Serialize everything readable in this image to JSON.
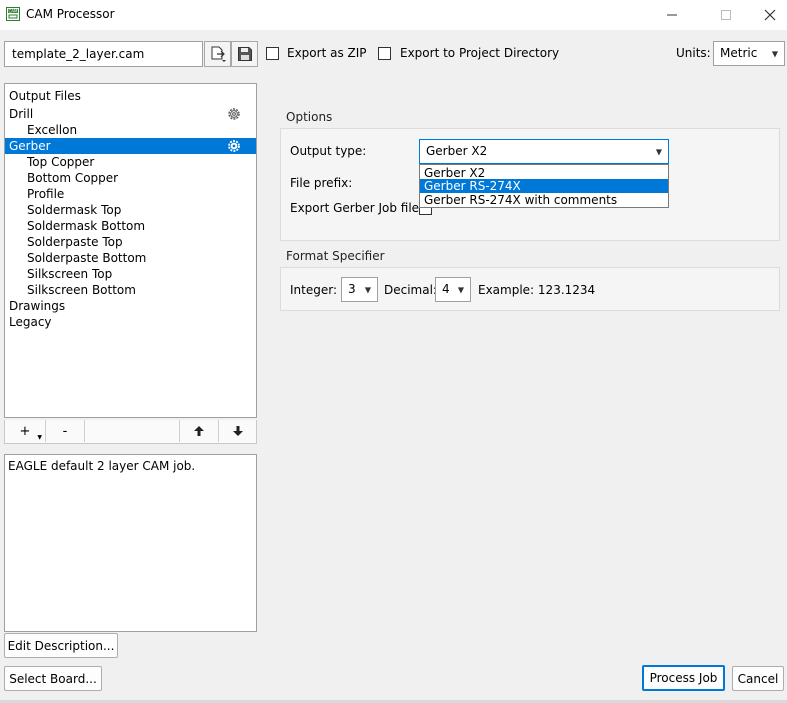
{
  "window": {
    "title": "CAM Processor",
    "icon": "cam-app-icon",
    "controls": [
      "minimize-icon",
      "maximize-icon",
      "close-icon"
    ]
  },
  "toolbar": {
    "job_file": "template_2_layer.cam",
    "open_icon": "open-file-icon",
    "save_icon": "save-icon",
    "export_zip": {
      "label": "Export as ZIP",
      "checked": false
    },
    "export_project_dir": {
      "label": "Export to Project Directory",
      "checked": false
    },
    "units_label": "Units:",
    "units_value": "Metric"
  },
  "tree": {
    "items": [
      {
        "label": "Output Files",
        "level": 0,
        "selected": false,
        "gear": false
      },
      {
        "label": "Drill",
        "level": 0,
        "selected": false,
        "gear": true
      },
      {
        "label": "Excellon",
        "level": 1,
        "selected": false,
        "gear": false
      },
      {
        "label": "Gerber",
        "level": 0,
        "selected": true,
        "gear": true
      },
      {
        "label": "Top Copper",
        "level": 1,
        "selected": false,
        "gear": false
      },
      {
        "label": "Bottom Copper",
        "level": 1,
        "selected": false,
        "gear": false
      },
      {
        "label": "Profile",
        "level": 1,
        "selected": false,
        "gear": false
      },
      {
        "label": "Soldermask Top",
        "level": 1,
        "selected": false,
        "gear": false
      },
      {
        "label": "Soldermask Bottom",
        "level": 1,
        "selected": false,
        "gear": false
      },
      {
        "label": "Solderpaste Top",
        "level": 1,
        "selected": false,
        "gear": false
      },
      {
        "label": "Solderpaste Bottom",
        "level": 1,
        "selected": false,
        "gear": false
      },
      {
        "label": "Silkscreen Top",
        "level": 1,
        "selected": false,
        "gear": false
      },
      {
        "label": "Silkscreen Bottom",
        "level": 1,
        "selected": false,
        "gear": false
      },
      {
        "label": "Drawings",
        "level": 0,
        "selected": false,
        "gear": false
      },
      {
        "label": "Legacy",
        "level": 0,
        "selected": false,
        "gear": false
      }
    ],
    "toolbar": {
      "add": "+",
      "remove": "-",
      "up_icon": "arrow-up-icon",
      "down_icon": "arrow-down-icon"
    }
  },
  "description": {
    "text": "EAGLE default 2 layer CAM job.",
    "edit_button": "Edit Description..."
  },
  "options": {
    "title": "Options",
    "output_type_label": "Output type:",
    "output_type_value": "Gerber X2",
    "output_type_options": [
      "Gerber X2",
      "Gerber RS-274X",
      "Gerber RS-274X with comments"
    ],
    "highlighted_option": "Gerber RS-274X",
    "file_prefix_label": "File prefix:",
    "export_job_label": "Export Gerber Job file:"
  },
  "format": {
    "title": "Format Specifier",
    "integer_label": "Integer:",
    "integer_value": "3",
    "decimal_label": "Decimal:",
    "decimal_value": "4",
    "example": "Example: 123.1234"
  },
  "footer": {
    "select_board": "Select Board...",
    "process_job": "Process Job",
    "cancel": "Cancel"
  },
  "colors": {
    "selection": "#0078d7",
    "window_bg": "#f0f0f0",
    "app_icon": "#2e7d32"
  }
}
